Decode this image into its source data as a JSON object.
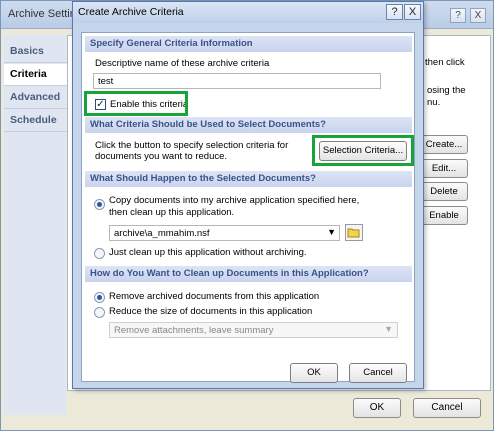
{
  "background": {
    "title": "Archive Settin",
    "tabs": [
      "Basics",
      "Criteria",
      "Advanced",
      "Schedule"
    ],
    "active_tab": "Criteria",
    "panel_text": [
      "then click",
      "osing the",
      "nu."
    ],
    "side_buttons": [
      "Create...",
      "Edit...",
      "Delete",
      "Enable"
    ],
    "ok_label": "OK",
    "cancel_label": "Cancel",
    "help_label": "?",
    "close_label": "X"
  },
  "dialog": {
    "title": "Create Archive Criteria",
    "help_label": "?",
    "close_label": "X",
    "section1": {
      "heading": "Specify General Criteria Information",
      "name_label": "Descriptive name of these archive criteria",
      "name_value": "test",
      "enable_label": "Enable this criteria",
      "enable_checked": true
    },
    "section2": {
      "heading": "What Criteria Should be Used to Select Documents?",
      "description_line1": "Click the button to specify selection criteria for",
      "description_line2": "documents you want to reduce.",
      "button_label": "Selection Criteria..."
    },
    "section3": {
      "heading": "What Should Happen to the Selected Documents?",
      "copy_option_line1": "Copy documents into my archive application specified here,",
      "copy_option_line2": "then clean up this application.",
      "archive_path": "archive\\a_mmahim.nsf",
      "cleanup_only_label": "Just clean up this application without archiving.",
      "selected": "copy"
    },
    "section4": {
      "heading": "How do You Want to Clean up Documents in this Application?",
      "remove_label": "Remove archived documents from this application",
      "reduce_label": "Reduce the size of documents in this application",
      "reduce_option_value": "Remove attachments, leave summary",
      "selected": "remove"
    },
    "ok_label": "OK",
    "cancel_label": "Cancel"
  },
  "colors": {
    "highlight": "#19a43a",
    "section_heading_text": "#3a5288",
    "dialog_frame": "#c5d5ec"
  }
}
